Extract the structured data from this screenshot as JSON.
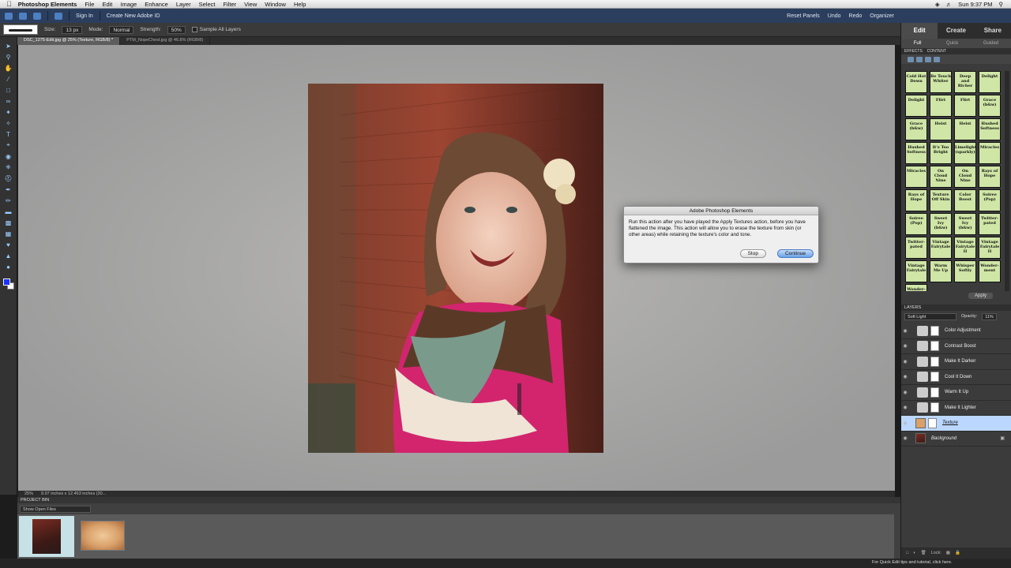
{
  "menubar": {
    "app": "Photoshop Elements",
    "items": [
      "File",
      "Edit",
      "Image",
      "Enhance",
      "Layer",
      "Select",
      "Filter",
      "View",
      "Window",
      "Help"
    ],
    "clock": "Sun 9:37 PM"
  },
  "appbar": {
    "sign_in": "Sign In",
    "create_new": "Create New Adobe ID",
    "reset_panels": "Reset Panels",
    "undo": "Undo",
    "redo": "Redo",
    "organizer": "Organizer"
  },
  "options": {
    "size_label": "Size:",
    "size_value": "13 px",
    "mode_label": "Mode:",
    "mode_value": "Normal",
    "strength_label": "Strength:",
    "strength_value": "50%",
    "sample_all_layers": "Sample All Layers"
  },
  "tabs": [
    {
      "label": "DSC_1275-Edit.jpg @ 25% (Texture, RGB/8) *"
    },
    {
      "label": "PTM_NopeChest.jpg @ 46.8% (RGB/8)"
    }
  ],
  "dialog": {
    "title": "Adobe Photoshop Elements",
    "message": "Run this action after you have played the Apply Textures action, before you have flattened the image. This action will allow you to erase the texture from skin (or other areas) while retaining the texture's color and tone.",
    "stop": "Stop",
    "continue": "Continue"
  },
  "status": {
    "zoom": "25%",
    "doc_size": "9.97 inches x 12.463 inches (30..."
  },
  "bin": {
    "title": "PROJECT BIN",
    "show": "Show Open Files"
  },
  "bottom": {
    "tip": "For Quick Edit tips and tutorial, click here."
  },
  "panel": {
    "tabs": [
      "Edit",
      "Create",
      "Share"
    ],
    "subtabs": [
      "Full",
      "Quick",
      "Guided"
    ],
    "effects_tabs": [
      "EFFECTS",
      "CONTENT"
    ],
    "apply": "Apply",
    "layers_title": "LAYERS",
    "blend_mode": "Soft Light",
    "opacity_label": "Opacity:",
    "opacity_value": "11%",
    "lock_label": "Lock:"
  },
  "effects": [
    "Cold Hot Down",
    "Be Touch Whiter",
    "Deep and Richer",
    "Delight",
    "Delight",
    "Flirt",
    "Flirt",
    "Grace (b&w)",
    "Grace (b&w)",
    "Heist",
    "Heist",
    "Hushed Softness",
    "Hushed Softness",
    "It's Too Bright",
    "Limelight (sparkly)",
    "Miracles",
    "Miracles",
    "On Cloud Nine",
    "On Cloud Nine",
    "Rays of Hope",
    "Rays of Hope",
    "Texture Off Skin",
    "Color Boost",
    "Soiree (Pop)",
    "Soiree (Pop)",
    "Sweet Ivy (b&w)",
    "Sweet Ivy (b&w)",
    "Twitter-pated",
    "Twitter-pated",
    "Vintage Fairytale",
    "Vintage Fairytale II",
    "Vintage Fairytale II",
    "Vintage Fairytale",
    "Warm Me Up",
    "Whisper Softly",
    "Wonder-ment",
    "Wonder-ment"
  ],
  "layers": [
    {
      "name": "Color Adjustment",
      "type": "adjustment",
      "selected": false
    },
    {
      "name": "Contrast Boost",
      "type": "adjustment",
      "selected": false
    },
    {
      "name": "Make It Darker",
      "type": "adjustment",
      "selected": false
    },
    {
      "name": "Cool It Down",
      "type": "adjustment",
      "selected": false
    },
    {
      "name": "Warm It Up",
      "type": "adjustment",
      "selected": false
    },
    {
      "name": "Make It Lighter",
      "type": "adjustment",
      "selected": false
    },
    {
      "name": "Texture",
      "type": "texture",
      "selected": true
    },
    {
      "name": "Background",
      "type": "background",
      "selected": false,
      "locked": true
    }
  ],
  "colors": {
    "foreground": "#1a33ff",
    "background": "#ffffff",
    "accent": "#2b3e5e",
    "selection": "#bcd7ff"
  }
}
